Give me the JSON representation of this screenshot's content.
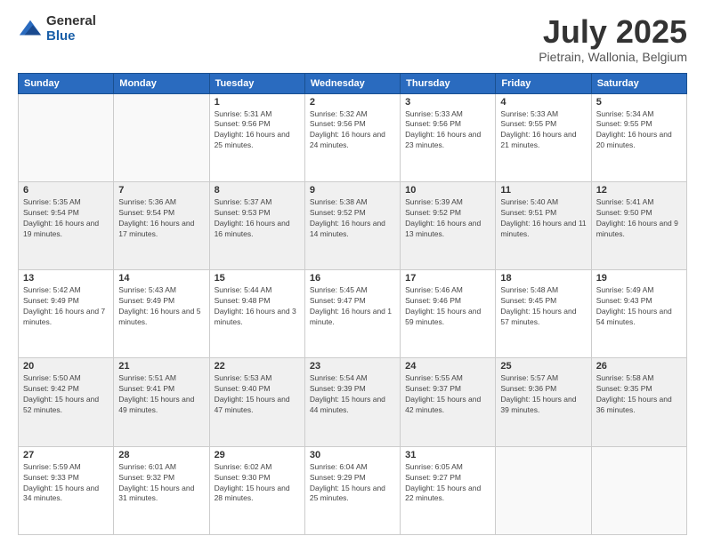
{
  "logo": {
    "general": "General",
    "blue": "Blue"
  },
  "header": {
    "month_year": "July 2025",
    "location": "Pietrain, Wallonia, Belgium"
  },
  "weekdays": [
    "Sunday",
    "Monday",
    "Tuesday",
    "Wednesday",
    "Thursday",
    "Friday",
    "Saturday"
  ],
  "weeks": [
    {
      "shaded": false,
      "days": [
        {
          "num": "",
          "info": ""
        },
        {
          "num": "",
          "info": ""
        },
        {
          "num": "1",
          "info": "Sunrise: 5:31 AM\nSunset: 9:56 PM\nDaylight: 16 hours and 25 minutes."
        },
        {
          "num": "2",
          "info": "Sunrise: 5:32 AM\nSunset: 9:56 PM\nDaylight: 16 hours and 24 minutes."
        },
        {
          "num": "3",
          "info": "Sunrise: 5:33 AM\nSunset: 9:56 PM\nDaylight: 16 hours and 23 minutes."
        },
        {
          "num": "4",
          "info": "Sunrise: 5:33 AM\nSunset: 9:55 PM\nDaylight: 16 hours and 21 minutes."
        },
        {
          "num": "5",
          "info": "Sunrise: 5:34 AM\nSunset: 9:55 PM\nDaylight: 16 hours and 20 minutes."
        }
      ]
    },
    {
      "shaded": true,
      "days": [
        {
          "num": "6",
          "info": "Sunrise: 5:35 AM\nSunset: 9:54 PM\nDaylight: 16 hours and 19 minutes."
        },
        {
          "num": "7",
          "info": "Sunrise: 5:36 AM\nSunset: 9:54 PM\nDaylight: 16 hours and 17 minutes."
        },
        {
          "num": "8",
          "info": "Sunrise: 5:37 AM\nSunset: 9:53 PM\nDaylight: 16 hours and 16 minutes."
        },
        {
          "num": "9",
          "info": "Sunrise: 5:38 AM\nSunset: 9:52 PM\nDaylight: 16 hours and 14 minutes."
        },
        {
          "num": "10",
          "info": "Sunrise: 5:39 AM\nSunset: 9:52 PM\nDaylight: 16 hours and 13 minutes."
        },
        {
          "num": "11",
          "info": "Sunrise: 5:40 AM\nSunset: 9:51 PM\nDaylight: 16 hours and 11 minutes."
        },
        {
          "num": "12",
          "info": "Sunrise: 5:41 AM\nSunset: 9:50 PM\nDaylight: 16 hours and 9 minutes."
        }
      ]
    },
    {
      "shaded": false,
      "days": [
        {
          "num": "13",
          "info": "Sunrise: 5:42 AM\nSunset: 9:49 PM\nDaylight: 16 hours and 7 minutes."
        },
        {
          "num": "14",
          "info": "Sunrise: 5:43 AM\nSunset: 9:49 PM\nDaylight: 16 hours and 5 minutes."
        },
        {
          "num": "15",
          "info": "Sunrise: 5:44 AM\nSunset: 9:48 PM\nDaylight: 16 hours and 3 minutes."
        },
        {
          "num": "16",
          "info": "Sunrise: 5:45 AM\nSunset: 9:47 PM\nDaylight: 16 hours and 1 minute."
        },
        {
          "num": "17",
          "info": "Sunrise: 5:46 AM\nSunset: 9:46 PM\nDaylight: 15 hours and 59 minutes."
        },
        {
          "num": "18",
          "info": "Sunrise: 5:48 AM\nSunset: 9:45 PM\nDaylight: 15 hours and 57 minutes."
        },
        {
          "num": "19",
          "info": "Sunrise: 5:49 AM\nSunset: 9:43 PM\nDaylight: 15 hours and 54 minutes."
        }
      ]
    },
    {
      "shaded": true,
      "days": [
        {
          "num": "20",
          "info": "Sunrise: 5:50 AM\nSunset: 9:42 PM\nDaylight: 15 hours and 52 minutes."
        },
        {
          "num": "21",
          "info": "Sunrise: 5:51 AM\nSunset: 9:41 PM\nDaylight: 15 hours and 49 minutes."
        },
        {
          "num": "22",
          "info": "Sunrise: 5:53 AM\nSunset: 9:40 PM\nDaylight: 15 hours and 47 minutes."
        },
        {
          "num": "23",
          "info": "Sunrise: 5:54 AM\nSunset: 9:39 PM\nDaylight: 15 hours and 44 minutes."
        },
        {
          "num": "24",
          "info": "Sunrise: 5:55 AM\nSunset: 9:37 PM\nDaylight: 15 hours and 42 minutes."
        },
        {
          "num": "25",
          "info": "Sunrise: 5:57 AM\nSunset: 9:36 PM\nDaylight: 15 hours and 39 minutes."
        },
        {
          "num": "26",
          "info": "Sunrise: 5:58 AM\nSunset: 9:35 PM\nDaylight: 15 hours and 36 minutes."
        }
      ]
    },
    {
      "shaded": false,
      "days": [
        {
          "num": "27",
          "info": "Sunrise: 5:59 AM\nSunset: 9:33 PM\nDaylight: 15 hours and 34 minutes."
        },
        {
          "num": "28",
          "info": "Sunrise: 6:01 AM\nSunset: 9:32 PM\nDaylight: 15 hours and 31 minutes."
        },
        {
          "num": "29",
          "info": "Sunrise: 6:02 AM\nSunset: 9:30 PM\nDaylight: 15 hours and 28 minutes."
        },
        {
          "num": "30",
          "info": "Sunrise: 6:04 AM\nSunset: 9:29 PM\nDaylight: 15 hours and 25 minutes."
        },
        {
          "num": "31",
          "info": "Sunrise: 6:05 AM\nSunset: 9:27 PM\nDaylight: 15 hours and 22 minutes."
        },
        {
          "num": "",
          "info": ""
        },
        {
          "num": "",
          "info": ""
        }
      ]
    }
  ]
}
